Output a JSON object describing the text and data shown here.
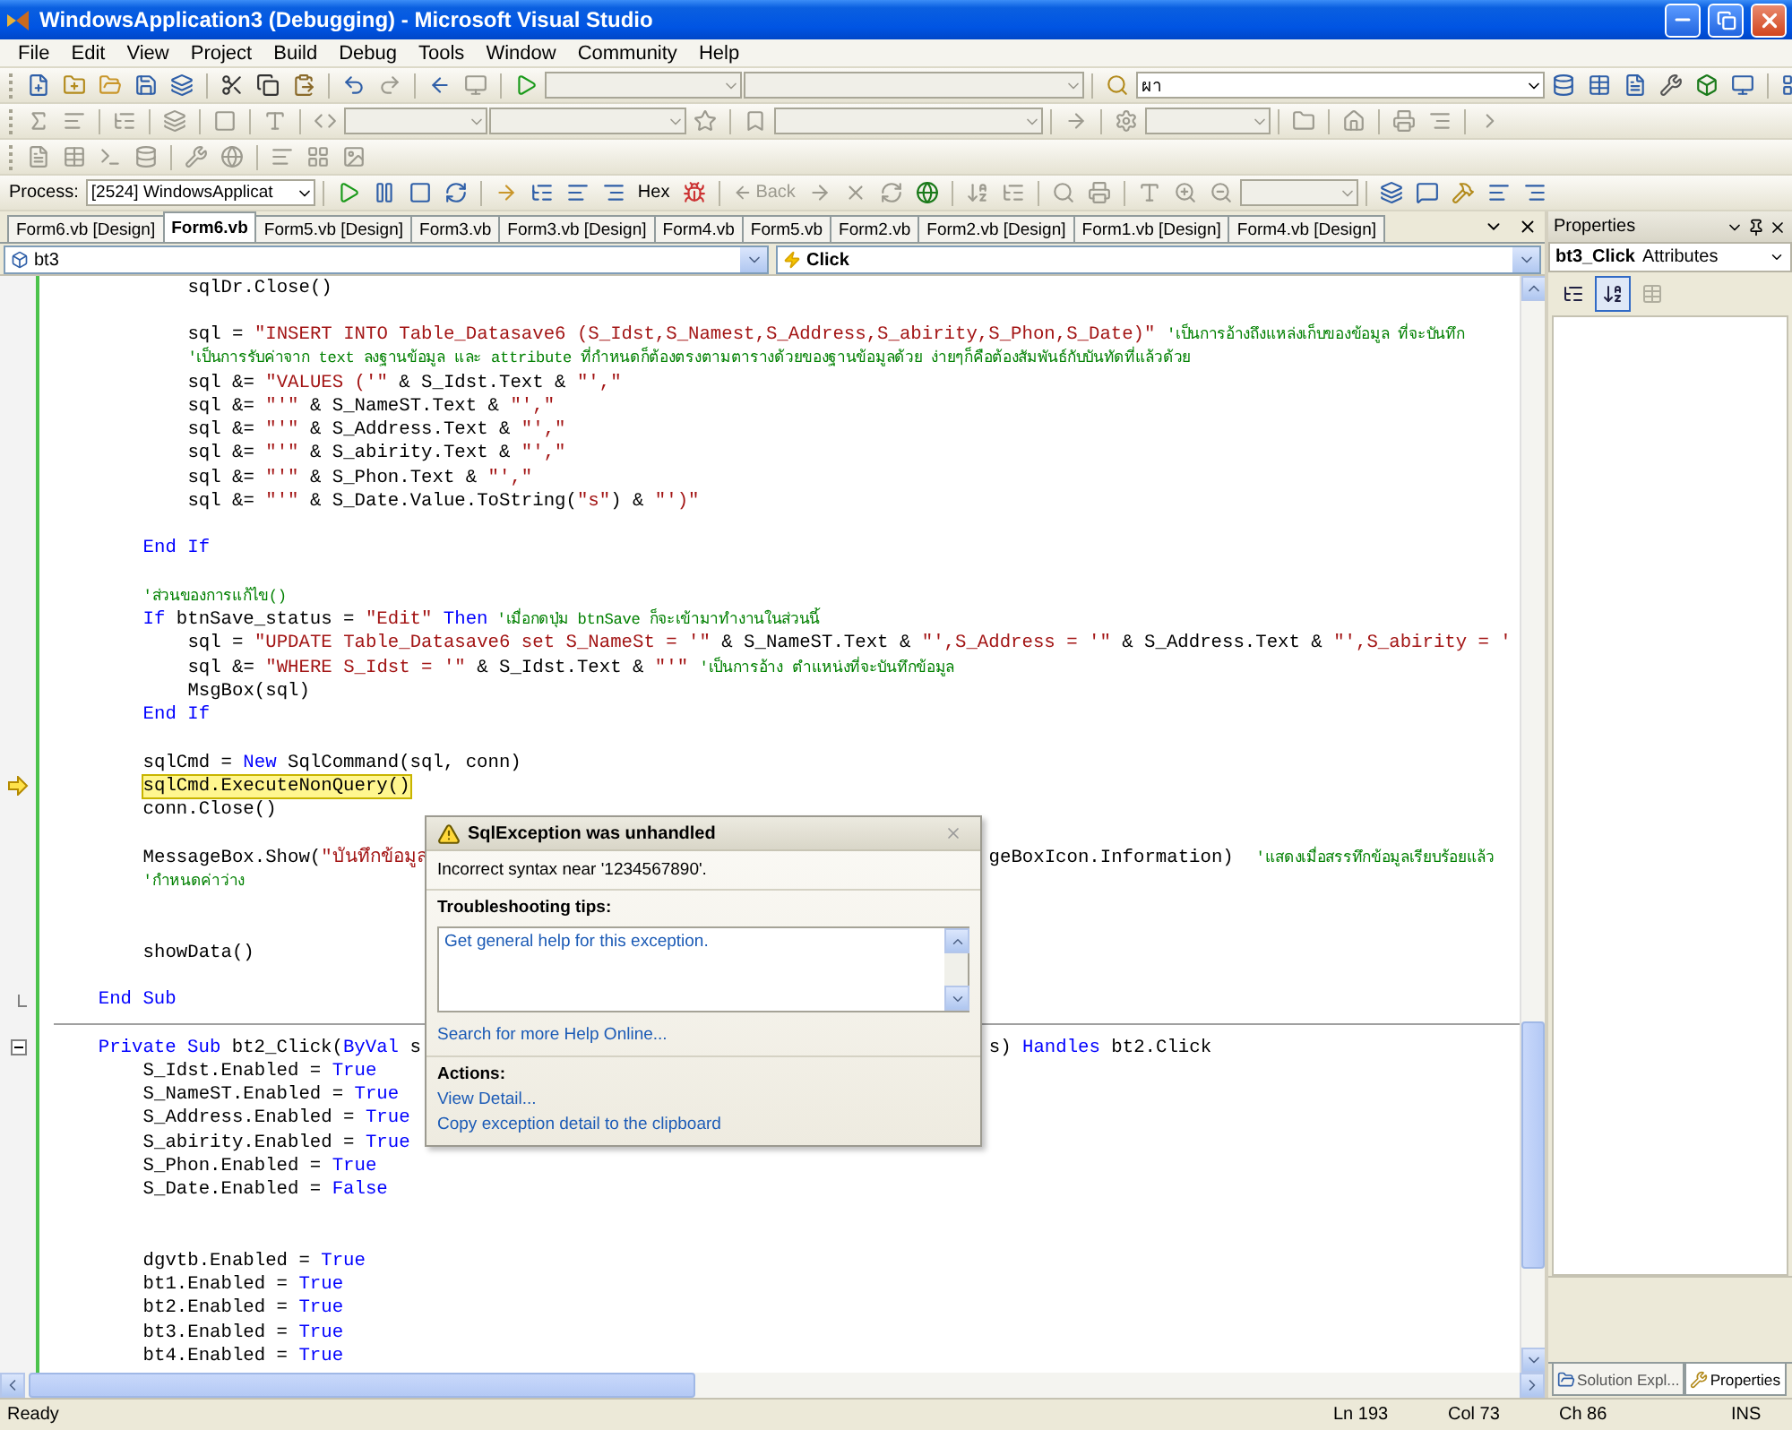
{
  "window": {
    "title": "WindowsApplication3 (Debugging) - Microsoft Visual Studio"
  },
  "menu": [
    "File",
    "Edit",
    "View",
    "Project",
    "Build",
    "Debug",
    "Tools",
    "Window",
    "Community",
    "Help"
  ],
  "toolbar": {
    "find_combo": "ผา",
    "process_label": "Process:",
    "process_value": "[2524] WindowsApplicat",
    "hex_button": "Hex",
    "back_button": "Back"
  },
  "tabs": [
    {
      "label": "Form6.vb [Design]",
      "selected": false
    },
    {
      "label": "Form6.vb",
      "selected": true
    },
    {
      "label": "Form5.vb [Design]",
      "selected": false
    },
    {
      "label": "Form3.vb",
      "selected": false
    },
    {
      "label": "Form3.vb [Design]",
      "selected": false
    },
    {
      "label": "Form4.vb",
      "selected": false
    },
    {
      "label": "Form5.vb",
      "selected": false
    },
    {
      "label": "Form2.vb",
      "selected": false
    },
    {
      "label": "Form2.vb [Design]",
      "selected": false
    },
    {
      "label": "Form1.vb [Design]",
      "selected": false
    },
    {
      "label": "Form4.vb [Design]",
      "selected": false
    }
  ],
  "editor": {
    "class_combo": "bt3",
    "method_combo": "Click",
    "lines": [
      {
        "kind": "block",
        "children": [
          {
            "kind": "block",
            "children": [
              {
                "kind": "code",
                "segs": [
                  {
                    "kind": "txt",
                    "text": "sqlDr.Close()"
                  }
                ]
              },
              {
                "kind": "blank"
              },
              {
                "kind": "code",
                "segs": [
                  {
                    "kind": "txt",
                    "text": "sql = "
                  },
                  {
                    "kind": "str",
                    "text": "\"INSERT INTO Table_Datasave6 (S_Idst,S_Namest,S_Address,S_abirity,S_Phon,S_Date)\" "
                  },
                  {
                    "kind": "cmt",
                    "text": "'เป็นการอ้างถึงแหล่งเก็บของข้อมูล ที่จะบันทึก"
                  }
                ]
              },
              {
                "kind": "code",
                "segs": [
                  {
                    "kind": "cmt",
                    "text": "'เป็นการรับค่าจาก text ลงฐานข้อมูล และ attribute ที่กำหนดก็ต้องตรงตามตารางด้วยของฐานข้อมูลด้วย ง่ายๆก็คือต้องสัมพันธ์กับบันทัดที่แล้วด้วย"
                  }
                ]
              },
              {
                "kind": "code",
                "segs": [
                  {
                    "kind": "txt",
                    "text": "sql &= "
                  },
                  {
                    "kind": "str",
                    "text": "\"VALUES ('\""
                  },
                  {
                    "kind": "txt",
                    "text": " & S_Idst.Text & "
                  },
                  {
                    "kind": "str",
                    "text": "\"',\""
                  }
                ]
              },
              {
                "kind": "code",
                "segs": [
                  {
                    "kind": "txt",
                    "text": "sql &= "
                  },
                  {
                    "kind": "str",
                    "text": "\"'\""
                  },
                  {
                    "kind": "txt",
                    "text": " & S_NameST.Text & "
                  },
                  {
                    "kind": "str",
                    "text": "\"',\""
                  }
                ]
              },
              {
                "kind": "code",
                "segs": [
                  {
                    "kind": "txt",
                    "text": "sql &= "
                  },
                  {
                    "kind": "str",
                    "text": "\"'\""
                  },
                  {
                    "kind": "txt",
                    "text": " & S_Address.Text & "
                  },
                  {
                    "kind": "str",
                    "text": "\"',\""
                  }
                ]
              },
              {
                "kind": "code",
                "segs": [
                  {
                    "kind": "txt",
                    "text": "sql &= "
                  },
                  {
                    "kind": "str",
                    "text": "\"'\""
                  },
                  {
                    "kind": "txt",
                    "text": " & S_abirity.Text & "
                  },
                  {
                    "kind": "str",
                    "text": "\"',\""
                  }
                ]
              },
              {
                "kind": "code",
                "segs": [
                  {
                    "kind": "txt",
                    "text": "sql &= "
                  },
                  {
                    "kind": "str",
                    "text": "\"'\""
                  },
                  {
                    "kind": "txt",
                    "text": " & S_Phon.Text & "
                  },
                  {
                    "kind": "str",
                    "text": "\"',\""
                  }
                ]
              },
              {
                "kind": "code",
                "segs": [
                  {
                    "kind": "txt",
                    "text": "sql &= "
                  },
                  {
                    "kind": "str",
                    "text": "\"'\""
                  },
                  {
                    "kind": "txt",
                    "text": " & S_Date.Value.ToString("
                  },
                  {
                    "kind": "str",
                    "text": "\"s\""
                  },
                  {
                    "kind": "txt",
                    "text": ") & "
                  },
                  {
                    "kind": "str",
                    "text": "\"')\""
                  }
                ]
              },
              {
                "kind": "blank"
              }
            ]
          },
          {
            "kind": "code",
            "segs": [
              {
                "kind": "kw",
                "text": "End If"
              }
            ]
          },
          {
            "kind": "blank"
          },
          {
            "kind": "code",
            "segs": [
              {
                "kind": "cmt",
                "text": "'ส่วนของการแก้ไข()"
              }
            ]
          },
          {
            "kind": "code",
            "segs": [
              {
                "kind": "kw",
                "text": "If"
              },
              {
                "kind": "txt",
                "text": " btnSave_status = "
              },
              {
                "kind": "str",
                "text": "\"Edit\" "
              },
              {
                "kind": "kw",
                "text": "Then"
              },
              {
                "kind": "cmt",
                "text": " 'เมื่อกดปุ่ม btnSave ก็จะเข้ามาทำงานในส่วนนี้"
              }
            ]
          },
          {
            "kind": "block",
            "children": [
              {
                "kind": "code",
                "segs": [
                  {
                    "kind": "txt",
                    "text": "sql = "
                  },
                  {
                    "kind": "str",
                    "text": "\"UPDATE Table_Datasave6 set S_NameSt = '\""
                  },
                  {
                    "kind": "txt",
                    "text": " & S_NameST.Text & "
                  },
                  {
                    "kind": "str",
                    "text": "\"',S_Address = '\""
                  },
                  {
                    "kind": "txt",
                    "text": " & S_Address.Text & "
                  },
                  {
                    "kind": "str",
                    "text": "\"',S_abirity = '"
                  }
                ]
              },
              {
                "kind": "code",
                "segs": [
                  {
                    "kind": "txt",
                    "text": "sql &= "
                  },
                  {
                    "kind": "str",
                    "text": "\"WHERE S_Idst = '\""
                  },
                  {
                    "kind": "txt",
                    "text": " & S_Idst.Text & "
                  },
                  {
                    "kind": "str",
                    "text": "\"'\" "
                  },
                  {
                    "kind": "cmt",
                    "text": "'เป็นการอ้าง ตำแหน่งที่จะบันทึกข้อมูล"
                  }
                ]
              },
              {
                "kind": "code",
                "segs": [
                  {
                    "kind": "txt",
                    "text": "MsgBox(sql)"
                  }
                ]
              }
            ]
          },
          {
            "kind": "code",
            "segs": [
              {
                "kind": "kw",
                "text": "End If"
              }
            ]
          },
          {
            "kind": "blank"
          },
          {
            "kind": "code",
            "segs": [
              {
                "kind": "txt",
                "text": "sqlCmd = "
              },
              {
                "kind": "kw",
                "text": "New"
              },
              {
                "kind": "txt",
                "text": " SqlCommand(sql, conn)"
              }
            ]
          },
          {
            "kind": "current",
            "segs": [
              {
                "kind": "txt",
                "text": "sqlCmd.ExecuteNonQuery()"
              }
            ]
          },
          {
            "kind": "code",
            "segs": [
              {
                "kind": "txt",
                "text": "conn.Close()"
              }
            ]
          },
          {
            "kind": "blank"
          },
          {
            "kind": "code",
            "segs": [
              {
                "kind": "txt",
                "text": "MessageBox.Show("
              },
              {
                "kind": "str",
                "text": "\"บันทึกข้อมูล"
              }
            ],
            "right": [
              {
                "kind": "txt",
                "text": "geBoxIcon.Information)  "
              },
              {
                "kind": "cmt",
                "text": "'แสดงเมื่อสรรทึกข้อมูลเรียบร้อยแล้ว"
              }
            ]
          },
          {
            "kind": "code",
            "segs": [
              {
                "kind": "cmt",
                "text": "'กำหนดค่าว่าง"
              }
            ]
          },
          {
            "kind": "blank"
          },
          {
            "kind": "blank"
          },
          {
            "kind": "code",
            "segs": [
              {
                "kind": "txt",
                "text": "showData()"
              }
            ]
          },
          {
            "kind": "blank"
          }
        ]
      },
      {
        "kind": "endsub",
        "segs": [
          {
            "kind": "kw",
            "text": "End Sub"
          }
        ]
      },
      {
        "kind": "rule"
      },
      {
        "kind": "sub",
        "segs": [
          {
            "kind": "kw",
            "text": "Private Sub"
          },
          {
            "kind": "txt",
            "text": " bt2_Click("
          },
          {
            "kind": "kw",
            "text": "ByVal"
          },
          {
            "kind": "txt",
            "text": " s"
          }
        ],
        "right": [
          {
            "kind": "txt",
            "text": "s) "
          },
          {
            "kind": "kw",
            "text": "Handles"
          },
          {
            "kind": "txt",
            "text": " bt2.Click"
          }
        ]
      },
      {
        "kind": "block",
        "children": [
          {
            "kind": "code",
            "segs": [
              {
                "kind": "txt",
                "text": "S_Idst.Enabled = "
              },
              {
                "kind": "kw",
                "text": "True"
              }
            ]
          },
          {
            "kind": "code",
            "segs": [
              {
                "kind": "txt",
                "text": "S_NameST.Enabled = "
              },
              {
                "kind": "kw",
                "text": "True"
              }
            ]
          },
          {
            "kind": "code",
            "segs": [
              {
                "kind": "txt",
                "text": "S_Address.Enabled = "
              },
              {
                "kind": "kw",
                "text": "True"
              }
            ]
          },
          {
            "kind": "code",
            "segs": [
              {
                "kind": "txt",
                "text": "S_abirity.Enabled = "
              },
              {
                "kind": "kw",
                "text": "True"
              }
            ]
          },
          {
            "kind": "code",
            "segs": [
              {
                "kind": "txt",
                "text": "S_Phon.Enabled = "
              },
              {
                "kind": "kw",
                "text": "True"
              }
            ]
          },
          {
            "kind": "code",
            "segs": [
              {
                "kind": "txt",
                "text": "S_Date.Enabled = "
              },
              {
                "kind": "kw",
                "text": "False"
              }
            ]
          },
          {
            "kind": "blank"
          },
          {
            "kind": "blank"
          },
          {
            "kind": "code",
            "segs": [
              {
                "kind": "txt",
                "text": "dgvtb.Enabled = "
              },
              {
                "kind": "kw",
                "text": "True"
              }
            ]
          },
          {
            "kind": "code",
            "segs": [
              {
                "kind": "txt",
                "text": "bt1.Enabled = "
              },
              {
                "kind": "kw",
                "text": "True"
              }
            ]
          },
          {
            "kind": "code",
            "segs": [
              {
                "kind": "txt",
                "text": "bt2.Enabled = "
              },
              {
                "kind": "kw",
                "text": "True"
              }
            ]
          },
          {
            "kind": "code",
            "segs": [
              {
                "kind": "txt",
                "text": "bt3.Enabled = "
              },
              {
                "kind": "kw",
                "text": "True"
              }
            ]
          },
          {
            "kind": "code",
            "segs": [
              {
                "kind": "txt",
                "text": "bt4.Enabled = "
              },
              {
                "kind": "kw",
                "text": "True"
              }
            ]
          }
        ]
      }
    ]
  },
  "exception_popup": {
    "title": "SqlException was unhandled",
    "message": "Incorrect syntax near '1234567890'.",
    "tips_heading": "Troubleshooting tips:",
    "tips": [
      "Get general help for this exception."
    ],
    "help_link": "Search for more Help Online...",
    "actions_heading": "Actions:",
    "actions": [
      "View Detail...",
      "Copy exception detail to the clipboard"
    ]
  },
  "properties": {
    "title": "Properties",
    "object_name": "bt3_Click",
    "object_type": "Attributes",
    "bottom_tabs": [
      {
        "label": "Solution Expl...",
        "selected": false
      },
      {
        "label": "Properties",
        "selected": true
      }
    ]
  },
  "status_bar": {
    "message": "Ready",
    "line": "Ln 193",
    "column": "Col 73",
    "char": "Ch 86",
    "mode": "INS"
  }
}
